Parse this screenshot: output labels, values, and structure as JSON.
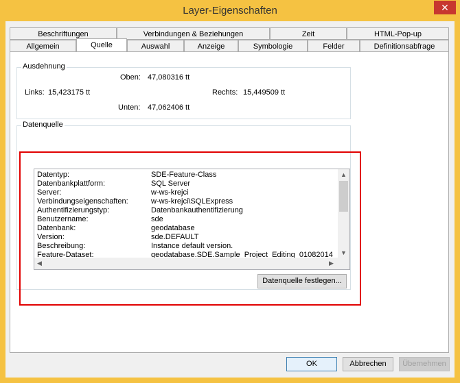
{
  "window": {
    "title": "Layer-Eigenschaften",
    "close_glyph": "✕"
  },
  "tabs": {
    "row1": [
      "Beschriftungen",
      "Verbindungen & Beziehungen",
      "Zeit",
      "HTML-Pop-up"
    ],
    "row2": [
      "Allgemein",
      "Quelle",
      "Auswahl",
      "Anzeige",
      "Symbologie",
      "Felder",
      "Definitionsabfrage"
    ],
    "active": "Quelle"
  },
  "extent": {
    "title": "Ausdehnung",
    "top_label": "Oben:",
    "top_value": "47,080316 tt",
    "left_label": "Links:",
    "left_value": "15,423175 tt",
    "right_label": "Rechts:",
    "right_value": "15,449509 tt",
    "bottom_label": "Unten:",
    "bottom_value": "47,062406 tt"
  },
  "datasource": {
    "title": "Datenquelle",
    "rows": [
      {
        "key": "Datentyp:",
        "value": "SDE-Feature-Class"
      },
      {
        "key": "Datenbankplattform:",
        "value": "SQL Server"
      },
      {
        "key": "Server:",
        "value": "w-ws-krejci"
      },
      {
        "key": "Verbindungseigenschaften:",
        "value": "w-ws-krejci\\SQLExpress"
      },
      {
        "key": "Authentifizierungstyp:",
        "value": "Datenbankauthentifizierung"
      },
      {
        "key": "Benutzername:",
        "value": "sde"
      },
      {
        "key": "Datenbank:",
        "value": "geodatabase"
      },
      {
        "key": "Version:",
        "value": "sde.DEFAULT"
      },
      {
        "key": "Beschreibung:",
        "value": "Instance default version."
      },
      {
        "key": "Feature-Dataset:",
        "value": "geodatabase.SDE.Sample_Project_Editing_01082014"
      }
    ],
    "set_button": "Datenquelle festlegen..."
  },
  "footer": {
    "ok": "OK",
    "cancel": "Abbrechen",
    "apply": "Übernehmen"
  },
  "colors": {
    "frame": "#f5c242",
    "close": "#c7372f",
    "highlight": "#e10000"
  }
}
